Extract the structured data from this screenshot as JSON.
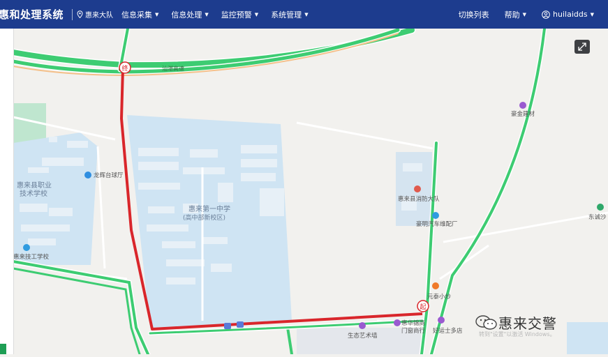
{
  "header": {
    "app_title": "惠和处理系统",
    "unit_name": "惠来大队",
    "menu": [
      {
        "label": "信息采集"
      },
      {
        "label": "信息处理"
      },
      {
        "label": "监控预警"
      },
      {
        "label": "系统管理"
      }
    ],
    "switch_list": "切换列表",
    "help": "帮助",
    "username": "huilaidds"
  },
  "map": {
    "labels": {
      "expressway": "汕湛高速",
      "school_main_1": "惠来第一中学",
      "school_main_2": "(高中部新校区)",
      "vocational_1": "惠来县职业",
      "vocational_2": "技术学校",
      "tech_school": "惠来技工学校",
      "billiards": "龙辉台球厅",
      "fire_station": "惠来县消防大队",
      "car_parts": "豪明汽车维配厂",
      "building_mat": "豪金建材",
      "dongcheng": "东诚沙",
      "snack": "元泰小炒",
      "art_street": "生态艺术墙",
      "store_1": "惠华锦商",
      "store_2": "门窗商行",
      "dorm": "好运士多店"
    },
    "markers": {
      "end": "终",
      "start": "起"
    },
    "route_color": "#d9262b",
    "road_color": "#3dcc72"
  },
  "watermark": {
    "brand": "惠来交警",
    "activate": "转到\"设置\"以激活 Windows。"
  }
}
